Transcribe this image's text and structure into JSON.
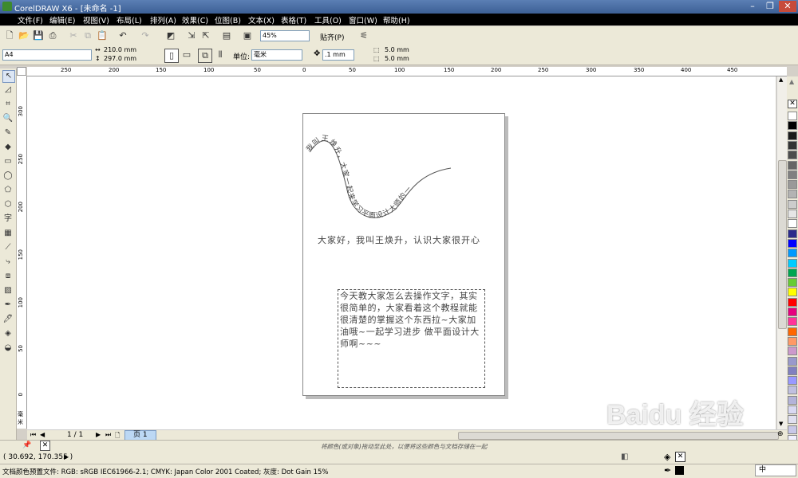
{
  "window": {
    "title": "CorelDRAW X6 - [未命名 -1]",
    "minimize": "–",
    "restore": "❐",
    "close": "✕"
  },
  "menu": [
    "文件(F)",
    "编辑(E)",
    "视图(V)",
    "布局(L)",
    "排列(A)",
    "效果(C)",
    "位图(B)",
    "文本(X)",
    "表格(T)",
    "工具(O)",
    "窗口(W)",
    "帮助(H)"
  ],
  "toolbar": {
    "zoom": "45%",
    "snap_label": "贴齐(P)"
  },
  "property_bar": {
    "page_size": "A4",
    "width": "210.0 mm",
    "height": "297.0 mm",
    "unit_label": "单位:",
    "unit": "毫米",
    "nudge": ".1 mm",
    "dup_x": "5.0 mm",
    "dup_y": "5.0 mm"
  },
  "rulers": {
    "h_ticks": [
      "250",
      "200",
      "150",
      "100",
      "50",
      "0",
      "50",
      "100",
      "150",
      "200",
      "250",
      "300",
      "350",
      "400",
      "450"
    ],
    "v_ticks": [
      "300",
      "250",
      "200",
      "150",
      "100",
      "50",
      "0"
    ],
    "v_unit": "毫米"
  },
  "document": {
    "path_text": "我叫王焕升，大家一起来学习平面设计大师的一",
    "artistic_text": "大家好，我叫王焕升，认识大家很开心",
    "paragraph_text": "今天教大家怎么去操作文字，其实很简单的，大家看着这个教程就能很清楚的掌握这个东西拉~大家加油哦~一起学习进步 做平面设计大师啊~~~"
  },
  "pager": {
    "count": "1 / 1",
    "tab": "页 1"
  },
  "status": {
    "hint": "将颜色(或对象)拖动至此处，以便将这些颜色与文档存储在一起",
    "coords": "( 30.692, 170.355 )",
    "color_profile": "文档颜色预置文件: RGB: sRGB IEC61966-2.1; CMYK: Japan Color 2001 Coated; 灰度: Dot Gain 15%",
    "ime": "中"
  },
  "watermark": "Baidu 经验",
  "palette": [
    "#ffffff",
    "#000000",
    "#1a1a1a",
    "#333333",
    "#4d4d4d",
    "#666666",
    "#808080",
    "#999999",
    "#b3b3b3",
    "#cccccc",
    "#e6e6e6",
    "#ffffff",
    "#2b2b8c",
    "#0000ff",
    "#0099ff",
    "#00ccff",
    "#00a651",
    "#66cc33",
    "#ffff00",
    "#ff0000",
    "#e6007e",
    "#ff3399",
    "#ff6600",
    "#ff9966",
    "#cc99cc",
    "#9999cc",
    "#8080c0",
    "#9999ff",
    "#c0c0e0",
    "#b3b3d9",
    "#d9d9f2",
    "#e0e0f0",
    "#c8c8e8",
    "#f0f0ff"
  ]
}
